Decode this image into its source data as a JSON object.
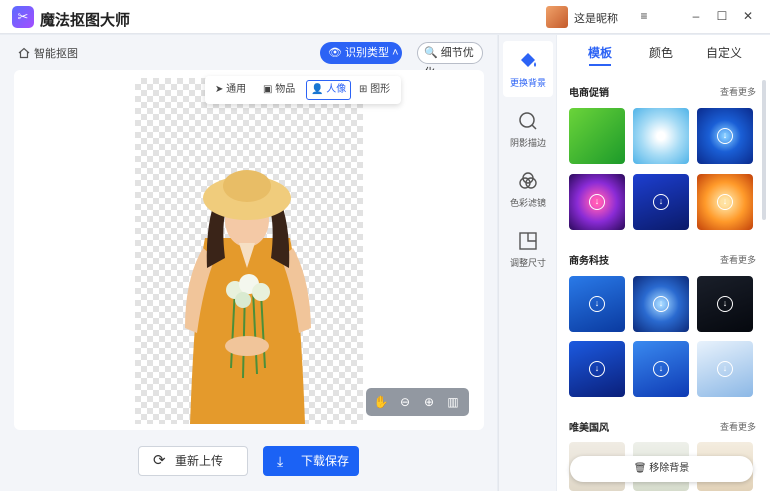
{
  "app": {
    "title": "魔法抠图大师",
    "user_name": "这是昵称"
  },
  "toolbar": {
    "smart_cut": "智能抠图",
    "identify_type": "识别类型",
    "detail_opt": "细节优化"
  },
  "type_menu": {
    "items": [
      "通用",
      "物品",
      "人像",
      "图形"
    ],
    "selected": "人像"
  },
  "actions": {
    "reupload": "重新上传",
    "download_save": "下载保存"
  },
  "tools": [
    {
      "label": "更换背景",
      "icon": "paint-bucket-icon",
      "active": true
    },
    {
      "label": "阴影描边",
      "icon": "shadow-outline-icon",
      "active": false
    },
    {
      "label": "色彩滤镜",
      "icon": "color-filter-icon",
      "active": false
    },
    {
      "label": "调整尺寸",
      "icon": "resize-icon",
      "active": false
    }
  ],
  "right_tabs": {
    "items": [
      "模板",
      "颜色",
      "自定义"
    ],
    "selected": "模板"
  },
  "sections": [
    {
      "title": "电商促销",
      "more": "查看更多"
    },
    {
      "title": "商务科技",
      "more": "查看更多"
    },
    {
      "title": "唯美国风",
      "more": "查看更多"
    }
  ],
  "remove_bg": "移除背景",
  "colors": {
    "accent": "#2c63f5",
    "save_button": "#1b62f5"
  }
}
